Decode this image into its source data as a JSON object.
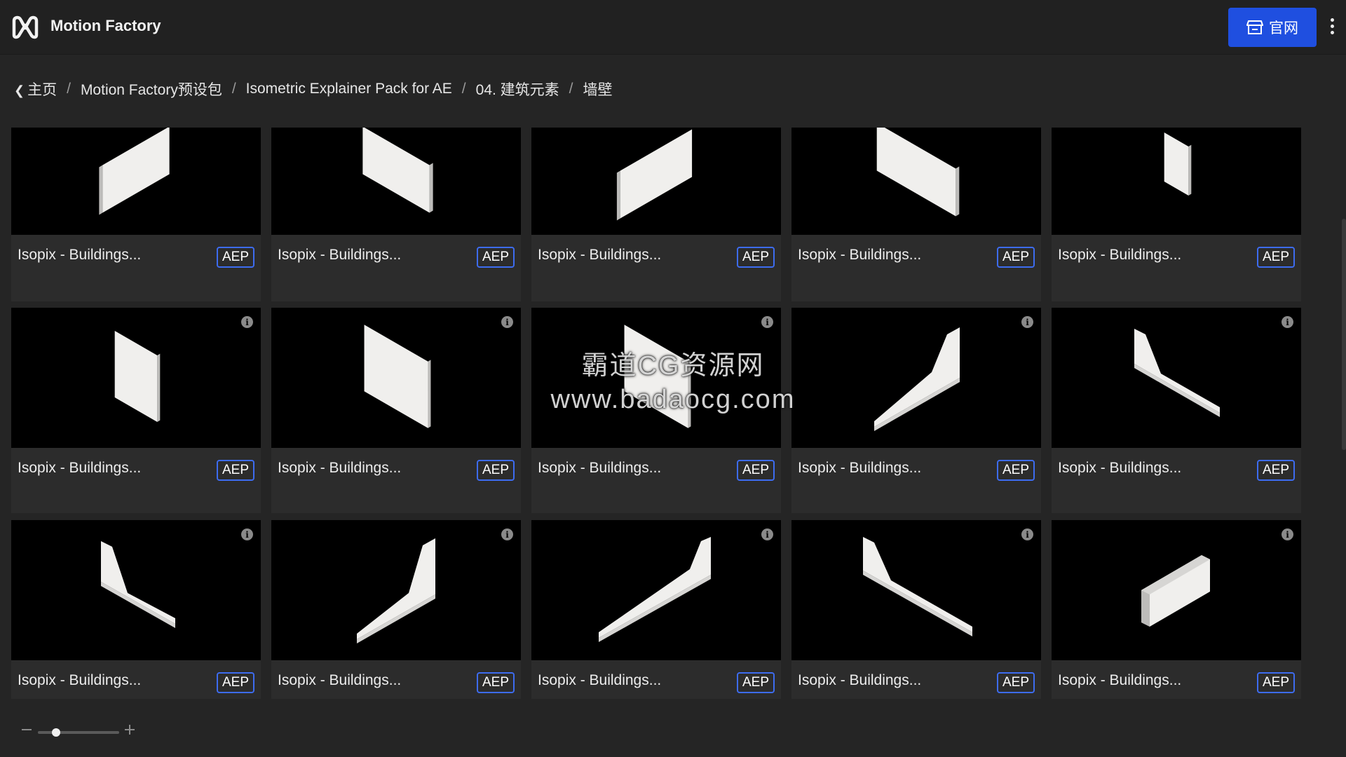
{
  "app": {
    "title": "Motion Factory",
    "site_button": "官网"
  },
  "breadcrumb": [
    "主页",
    "Motion Factory预设包",
    "Isometric Explainer Pack for AE",
    "04. 建筑元素",
    "墙壁"
  ],
  "breadcrumb_separator": "/",
  "cards": [
    {
      "name": "Isopix - Buildings...",
      "badge": "AEP",
      "info": false
    },
    {
      "name": "Isopix - Buildings...",
      "badge": "AEP",
      "info": false
    },
    {
      "name": "Isopix - Buildings...",
      "badge": "AEP",
      "info": false
    },
    {
      "name": "Isopix - Buildings...",
      "badge": "AEP",
      "info": false
    },
    {
      "name": "Isopix - Buildings...",
      "badge": "AEP",
      "info": false
    },
    {
      "name": "Isopix - Buildings...",
      "badge": "AEP",
      "info": true
    },
    {
      "name": "Isopix - Buildings...",
      "badge": "AEP",
      "info": true
    },
    {
      "name": "Isopix - Buildings...",
      "badge": "AEP",
      "info": true
    },
    {
      "name": "Isopix - Buildings...",
      "badge": "AEP",
      "info": true
    },
    {
      "name": "Isopix - Buildings...",
      "badge": "AEP",
      "info": true
    },
    {
      "name": "Isopix - Buildings...",
      "badge": "AEP",
      "info": true
    },
    {
      "name": "Isopix - Buildings...",
      "badge": "AEP",
      "info": true
    },
    {
      "name": "Isopix - Buildings...",
      "badge": "AEP",
      "info": true
    },
    {
      "name": "Isopix - Buildings...",
      "badge": "AEP",
      "info": true
    },
    {
      "name": "Isopix - Buildings...",
      "badge": "AEP",
      "info": true
    }
  ],
  "watermark": {
    "line1": "霸道CG资源网",
    "line2": "www.badaocg.com"
  },
  "zoom": {
    "level": 0.2
  },
  "colors": {
    "accent": "#1f4fe0",
    "badge_border": "#3d6cf0",
    "card_bg": "#2c2c2c",
    "thumb_bg": "#000000"
  },
  "icons": {
    "logo": "motion-factory-logo",
    "site": "storefront-icon",
    "menu": "kebab-menu-icon",
    "info": "info-icon"
  }
}
